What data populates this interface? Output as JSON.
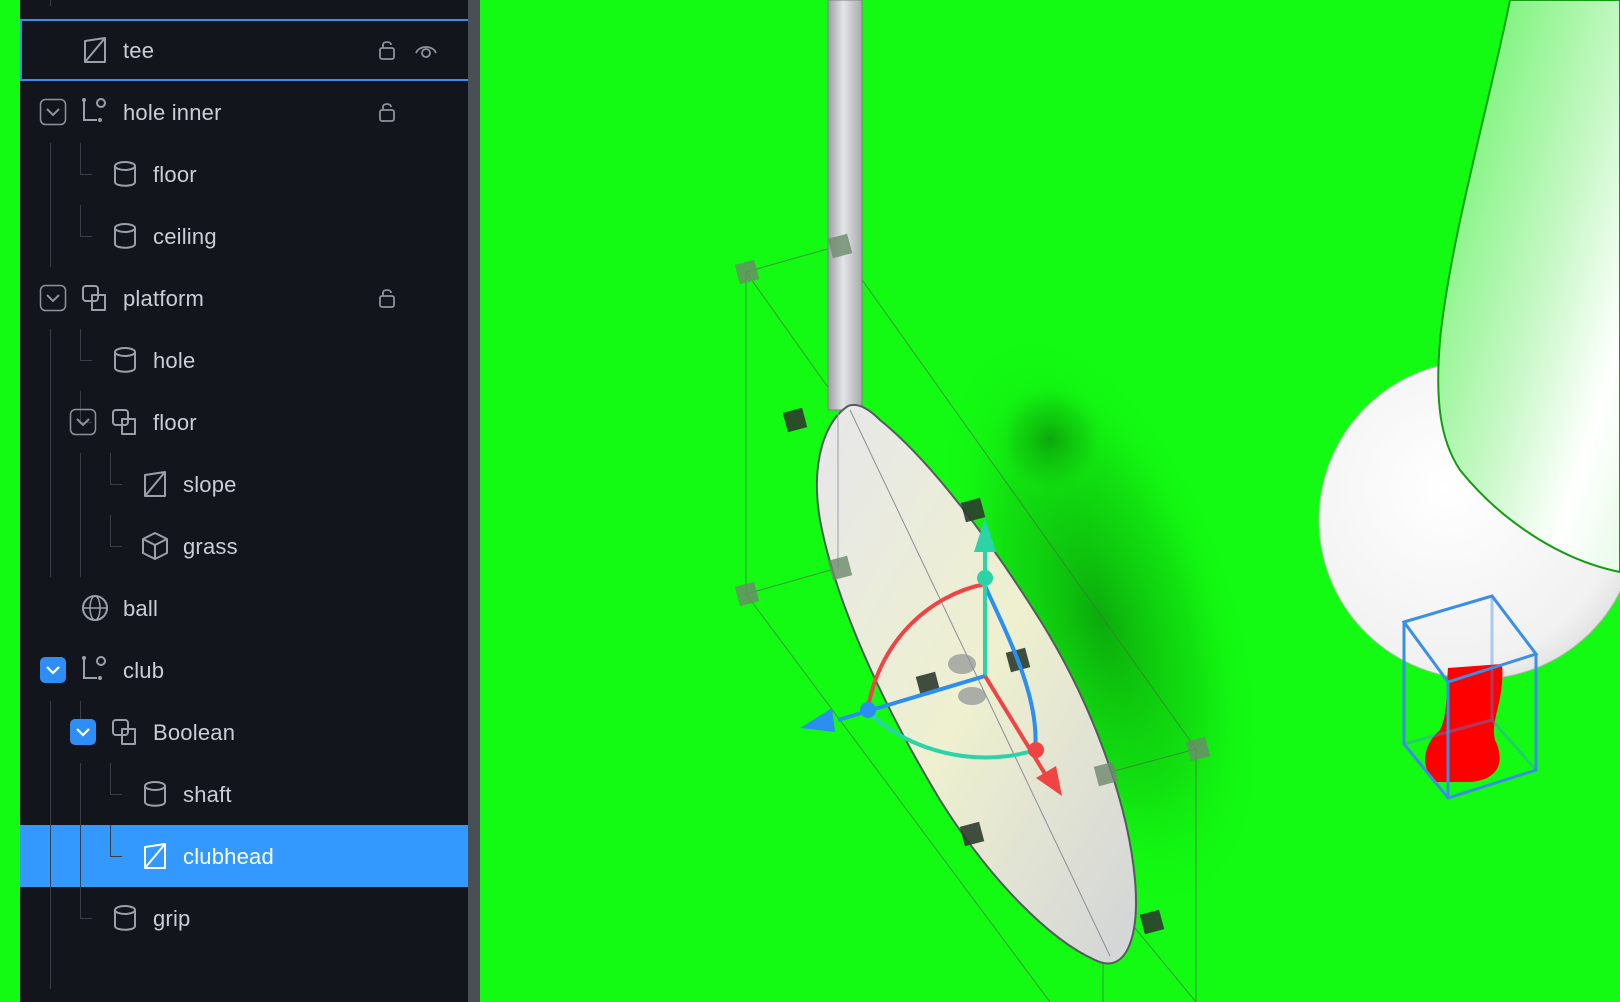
{
  "outliner": {
    "items": [
      {
        "label": "tee",
        "icon": "face-icon",
        "depth": 1,
        "toggle": "none",
        "lock": true,
        "visibility": true,
        "selected": false,
        "focused": true
      },
      {
        "label": "hole inner",
        "icon": "group-icon",
        "depth": 1,
        "toggle": "expanded",
        "lock": true,
        "visibility": false,
        "selected": false,
        "focused": false
      },
      {
        "label": "floor",
        "icon": "cylinder-icon",
        "depth": 2,
        "toggle": "none",
        "lock": false,
        "visibility": false,
        "selected": false,
        "focused": false
      },
      {
        "label": "ceiling",
        "icon": "cylinder-icon",
        "depth": 2,
        "toggle": "none",
        "lock": false,
        "visibility": false,
        "selected": false,
        "focused": false
      },
      {
        "label": "platform",
        "icon": "boolean-icon",
        "depth": 1,
        "toggle": "expanded",
        "lock": true,
        "visibility": false,
        "selected": false,
        "focused": false
      },
      {
        "label": "hole",
        "icon": "cylinder-icon",
        "depth": 2,
        "toggle": "none",
        "lock": false,
        "visibility": false,
        "selected": false,
        "focused": false
      },
      {
        "label": "floor",
        "icon": "boolean-icon",
        "depth": 2,
        "toggle": "expanded",
        "lock": false,
        "visibility": false,
        "selected": false,
        "focused": false
      },
      {
        "label": "slope",
        "icon": "face-icon",
        "depth": 3,
        "toggle": "none",
        "lock": false,
        "visibility": false,
        "selected": false,
        "focused": false
      },
      {
        "label": "grass",
        "icon": "cube-icon",
        "depth": 3,
        "toggle": "none",
        "lock": false,
        "visibility": false,
        "selected": false,
        "focused": false
      },
      {
        "label": "ball",
        "icon": "sphere-icon",
        "depth": 1,
        "toggle": "none",
        "lock": false,
        "visibility": false,
        "selected": false,
        "focused": false
      },
      {
        "label": "club",
        "icon": "group-icon",
        "depth": 1,
        "toggle": "checked",
        "lock": false,
        "visibility": false,
        "selected": false,
        "focused": false
      },
      {
        "label": "Boolean",
        "icon": "boolean-icon",
        "depth": 2,
        "toggle": "checked",
        "lock": false,
        "visibility": false,
        "selected": false,
        "focused": false
      },
      {
        "label": "shaft",
        "icon": "cylinder-icon",
        "depth": 3,
        "toggle": "none",
        "lock": false,
        "visibility": false,
        "selected": false,
        "focused": false
      },
      {
        "label": "clubhead",
        "icon": "face-icon",
        "depth": 3,
        "toggle": "none",
        "lock": false,
        "visibility": false,
        "selected": true,
        "focused": false
      },
      {
        "label": "grip",
        "icon": "cylinder-icon",
        "depth": 2,
        "toggle": "none",
        "lock": false,
        "visibility": false,
        "selected": false,
        "focused": false
      }
    ]
  },
  "colors": {
    "viewport_background": "#13fb12",
    "panel_background": "#12161c",
    "selection": "#3399ff",
    "gizmo_x": "#f04444",
    "gizmo_y": "#2ad4a8",
    "gizmo_z": "#2b8ef0",
    "tee": "#ff0000"
  }
}
